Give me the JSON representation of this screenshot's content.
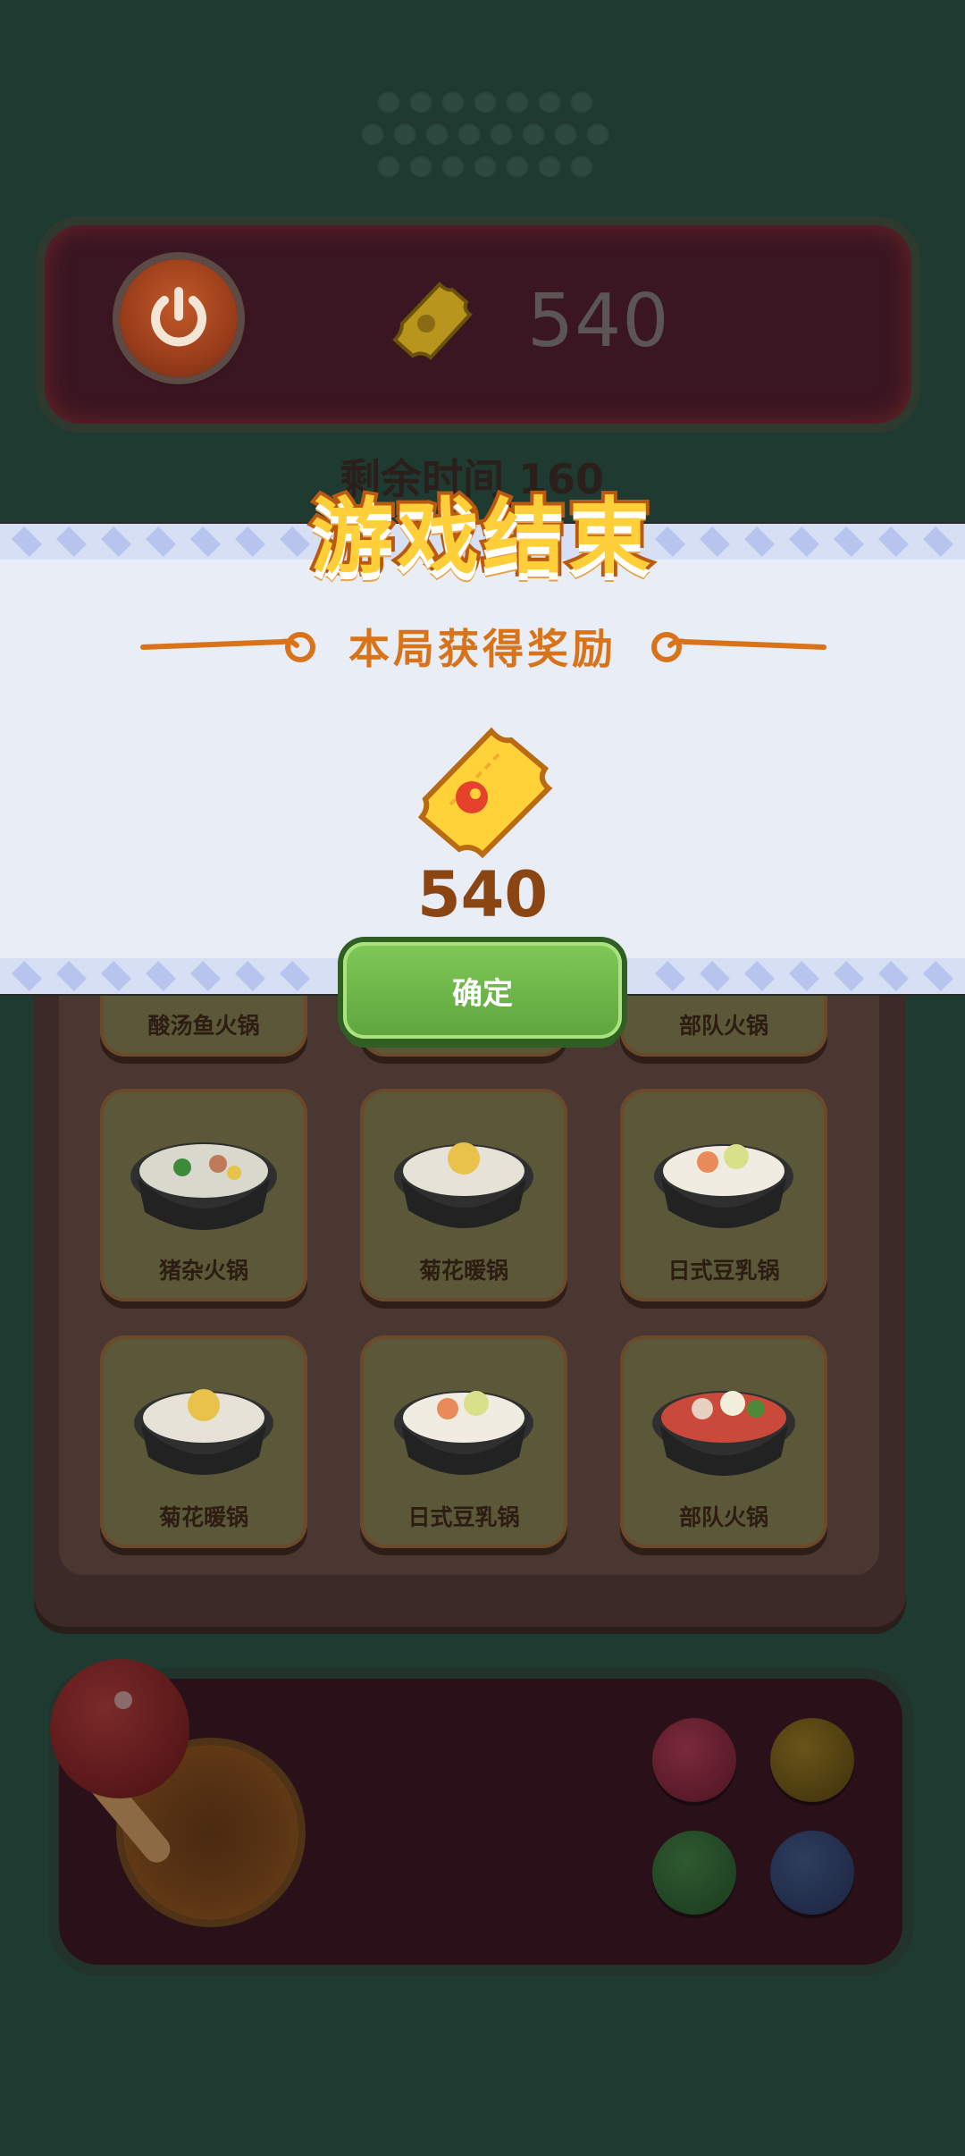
{
  "hud": {
    "score": "540",
    "time_label": "剩余时间 160"
  },
  "board": {
    "cards": [
      {
        "label": "酸汤鱼火锅"
      },
      {
        "label": ""
      },
      {
        "label": "部队火锅"
      },
      {
        "label": "猪杂火锅"
      },
      {
        "label": "菊花暖锅"
      },
      {
        "label": "日式豆乳锅"
      },
      {
        "label": "菊花暖锅"
      },
      {
        "label": "日式豆乳锅"
      },
      {
        "label": "部队火锅"
      }
    ]
  },
  "modal": {
    "title": "游戏结束",
    "reward_title": "本局获得奖励",
    "reward_amount": "540",
    "confirm_label": "确定"
  },
  "icons": {
    "power": "power-icon",
    "ticket": "ticket-icon",
    "joystick": "joystick-icon"
  },
  "colors": {
    "accent_orange": "#d9731a",
    "button_green": "#6fb84a",
    "title_yellow": "#ffcf3a",
    "modal_bg": "#e8edf6"
  }
}
